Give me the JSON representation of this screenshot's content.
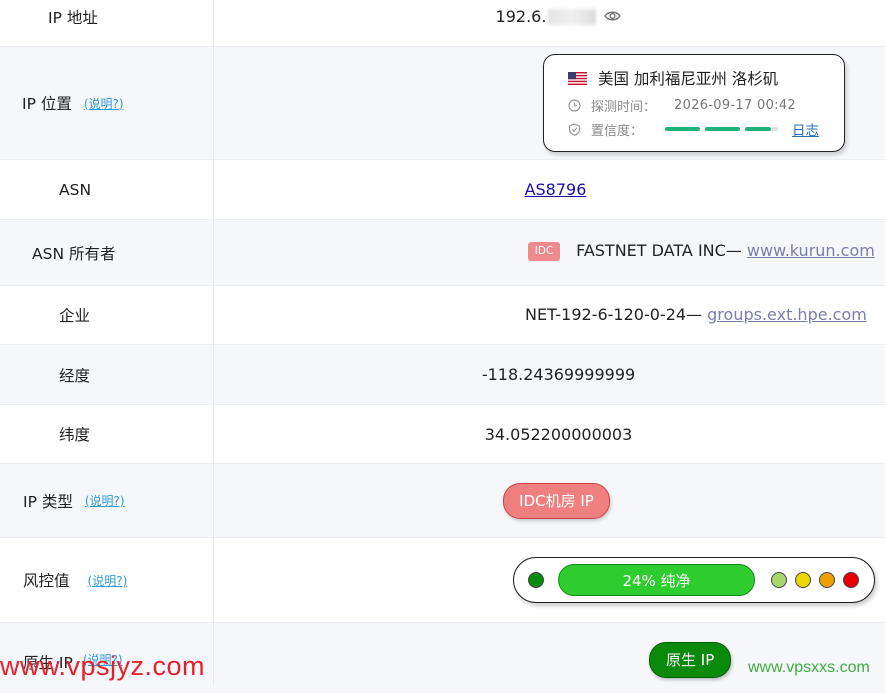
{
  "rows": {
    "ip": {
      "label": "IP 地址",
      "value": "192.6."
    },
    "location": {
      "label": "IP 位置",
      "help": "(说明?)",
      "place": "美国 加利福尼亚州 洛杉矶",
      "time_label": "探测时间：",
      "time_value": "2026-09-17 00:42",
      "confidence_label": "置信度：",
      "confidence_fraction": 0.93,
      "log_link": "日志"
    },
    "asn": {
      "label": "ASN",
      "value": "AS8796"
    },
    "asn_owner": {
      "label": "ASN 所有者",
      "badge": "IDC",
      "name": "FASTNET DATA INC—",
      "link": "www.kurun.com"
    },
    "company": {
      "label": "企业",
      "name": "NET-192-6-120-0-24—",
      "link": "groups.ext.hpe.com"
    },
    "longitude": {
      "label": "经度",
      "value": "-118.24369999999"
    },
    "latitude": {
      "label": "纬度",
      "value": "34.052200000003"
    },
    "ip_type": {
      "label": "IP 类型",
      "help": "(说明?)",
      "value": "IDC机房 IP"
    },
    "risk": {
      "label": "风控值",
      "help": "(说明?)",
      "value": "24%  纯净",
      "percent": 24,
      "dot_colors": [
        "#0a8a0a",
        "#a8d66a",
        "#e8d800",
        "#f0a000",
        "#e80000"
      ]
    },
    "native_ip": {
      "label": "原生 IP",
      "help": "(说明?)",
      "value": "原生 IP"
    }
  },
  "watermarks": {
    "left": "www.vpsjyz.com",
    "right": "www.vpsxxs.com"
  },
  "colors": {
    "link": "#1a0dab",
    "help": "#2f9cd8",
    "idc": "#f08080",
    "native": "#0a8a0a",
    "confidence": "#1fb37a"
  }
}
